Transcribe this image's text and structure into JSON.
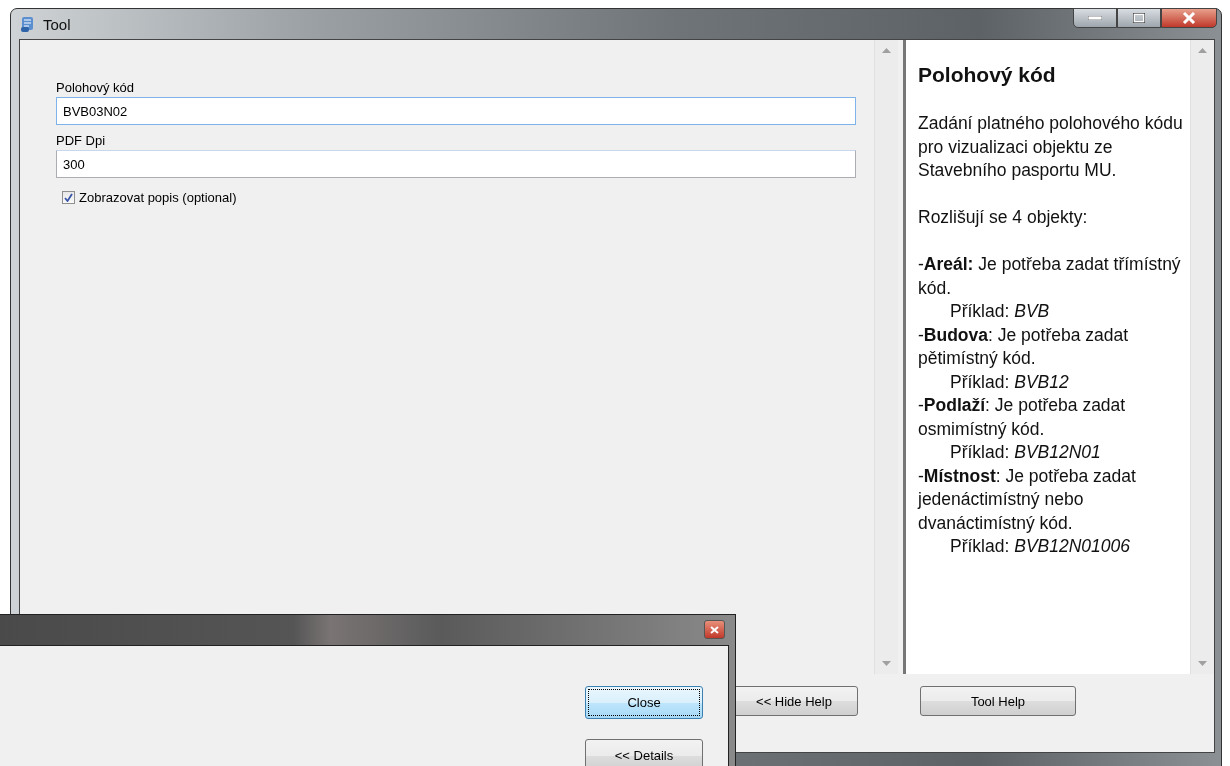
{
  "window": {
    "title": "Tool"
  },
  "form": {
    "fields": [
      {
        "label": "Polohový kód",
        "value": "BVB03N02"
      },
      {
        "label": "PDF Dpi",
        "value": "300"
      }
    ],
    "checkbox": {
      "label": "Zobrazovat popis (optional)",
      "checked": true
    }
  },
  "help": {
    "heading": "Polohový kód",
    "paragraphs": [
      "Zadání platného polohového kódu pro vizualizaci objektu ze Stavebního pasportu MU.",
      "Rozlišují se 4 objekty:"
    ],
    "entries": [
      {
        "text": "-**Areál:** Je potřeba zadat třímístný kód.",
        "example": "Příklad: *BVB*"
      },
      {
        "text": "-**Budova**: Je potřeba zadat pětimístný kód.",
        "example": "Příklad: *BVB12*"
      },
      {
        "text": "-**Podlaží**: Je potřeba zadat osmimístný kód.",
        "example": "Příklad: *BVB12N01*"
      },
      {
        "text": "-**Místnost**: Je potřeba zadat jedenáctimístný nebo dvanáctimístný kód.",
        "example": "Příklad: *BVB12N01006*"
      }
    ]
  },
  "buttons": [
    "<< Hide Help",
    "Tool Help"
  ],
  "dialog": {
    "buttons": [
      {
        "label": "Close",
        "focused": true
      },
      {
        "label": "<< Details",
        "focused": false
      }
    ]
  }
}
